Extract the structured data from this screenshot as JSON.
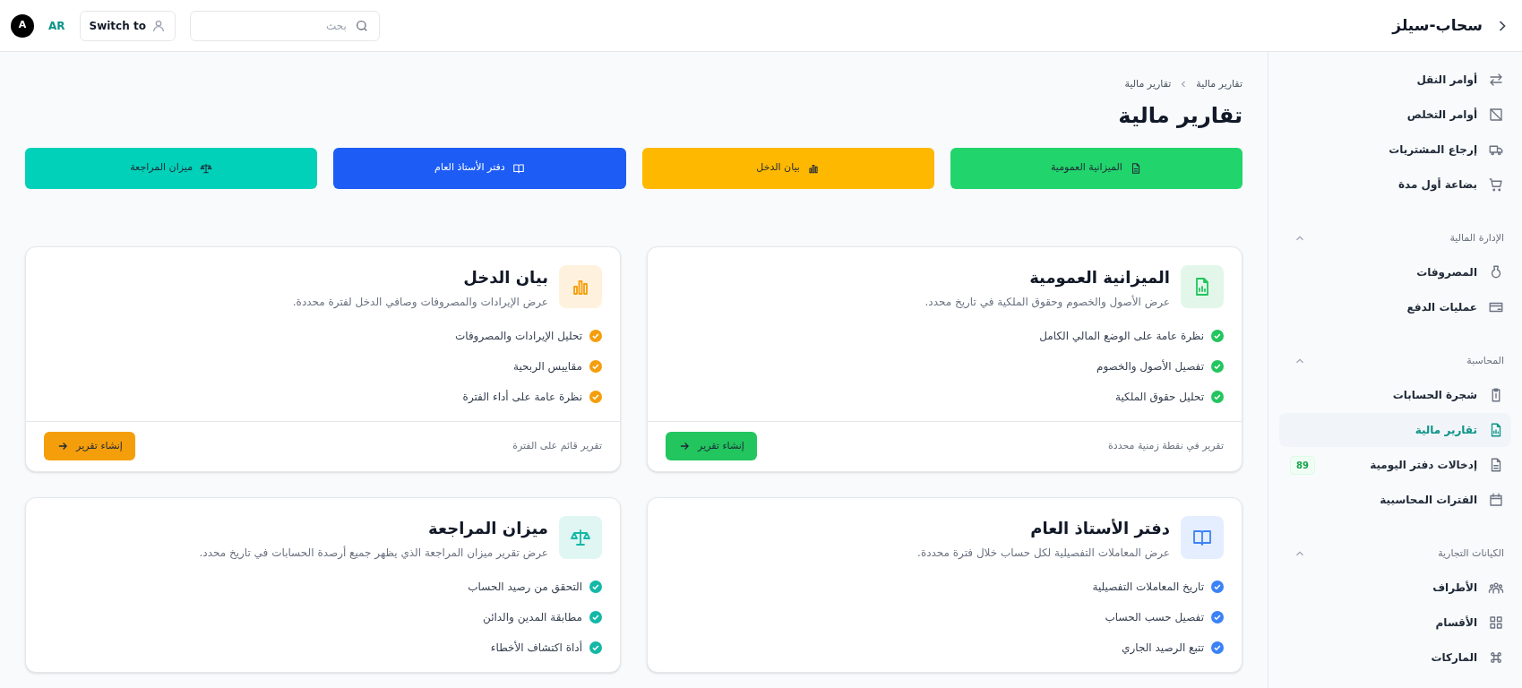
{
  "topbar": {
    "brand": "سحاب-سيلز",
    "search": {
      "placeholder": "بحث"
    },
    "switch_button": "Switch to",
    "language": "AR",
    "avatar": "A"
  },
  "sidebar": {
    "items": [
      {
        "label": "أوامر النقل",
        "selected": false
      },
      {
        "label": "أوامر التخلص",
        "selected": false
      },
      {
        "label": "إرجاع المشتريات",
        "selected": false
      },
      {
        "label": "بضاعة أول مدة",
        "selected": false
      }
    ],
    "sections": [
      {
        "title": "الإدارة المالية",
        "expanded": true,
        "items": [
          {
            "label": "المصروفات",
            "selected": false
          },
          {
            "label": "عمليات الدفع",
            "selected": false
          }
        ]
      },
      {
        "title": "المحاسبة",
        "expanded": true,
        "items": [
          {
            "label": "شجرة الحسابات",
            "selected": false
          },
          {
            "label": "تقارير مالية",
            "selected": true
          },
          {
            "label": "إدخالات دفتر اليومية",
            "selected": false,
            "badge": "89"
          },
          {
            "label": "الفترات المحاسبية",
            "selected": false
          }
        ]
      },
      {
        "title": "الكيانات التجارية",
        "expanded": true,
        "items": [
          {
            "label": "الأطراف",
            "selected": false
          },
          {
            "label": "الأقسام",
            "selected": false
          },
          {
            "label": "الماركات",
            "selected": false
          }
        ]
      }
    ]
  },
  "breadcrumb": [
    "تقارير مالية",
    "تقارير مالية"
  ],
  "title": "تقارير مالية",
  "quick_buttons": [
    {
      "label": "الميزانية العمومية",
      "color": "#22d46c"
    },
    {
      "label": "بيان الدخل",
      "color": "#ffb800"
    },
    {
      "label": "دفتر الأستاذ العام",
      "color": "#1d5cf5"
    },
    {
      "label": "ميزان المراجعة",
      "color": "#00d1b8"
    }
  ],
  "cards": [
    {
      "title": "الميزانية العمومية",
      "description": "عرض الأصول والخصوم وحقوق الملكية في تاريخ محدد.",
      "color": "#22c55e",
      "features": [
        "نظرة عامة على الوضع المالي الكامل",
        "تفصيل الأصول والخصوم",
        "تحليل حقوق الملكية"
      ],
      "footer_note": "تقرير في نقطة زمنية محددة",
      "action": "إنشاء تقرير"
    },
    {
      "title": "بيان الدخل",
      "description": "عرض الإيرادات والمصروفات وصافي الدخل لفترة محددة.",
      "color": "#f59e0b",
      "features": [
        "تحليل الإيرادات والمصروفات",
        "مقاييس الربحية",
        "نظرة عامة على أداء الفترة"
      ],
      "footer_note": "تقرير قائم على الفترة",
      "action": "إنشاء تقرير"
    },
    {
      "title": "دفتر الأستاذ العام",
      "description": "عرض المعاملات التفصيلية لكل حساب خلال فترة محددة.",
      "color": "#3b82f6",
      "features": [
        "تاريخ المعاملات التفصيلية",
        "تفصيل حسب الحساب",
        "تتبع الرصيد الجاري"
      ]
    },
    {
      "title": "ميزان المراجعة",
      "description": "عرض تقرير ميزان المراجعة الذي يظهر جميع أرصدة الحسابات في تاريخ محدد.",
      "color": "#14b8a6",
      "features": [
        "التحقق من رصيد الحساب",
        "مطابقة المدين والدائن",
        "أداة اكتشاف الأخطاء"
      ]
    }
  ]
}
